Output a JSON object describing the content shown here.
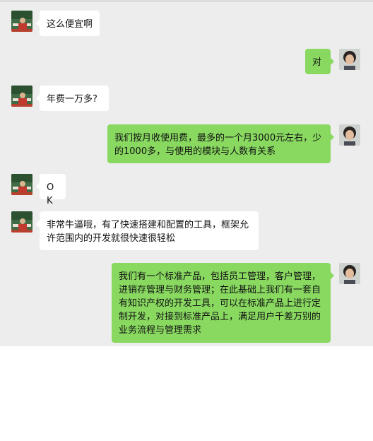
{
  "messages": [
    {
      "side": "in",
      "text": "这么便宜啊",
      "avatar": "contact-avatar"
    },
    {
      "side": "out",
      "text": "对",
      "avatar": "self-avatar"
    },
    {
      "side": "in",
      "text": "年费一万多?",
      "avatar": "contact-avatar"
    },
    {
      "side": "out",
      "text": "我们按月收使用费，最多的一个月3000元左右，少的1000多，与使用的模块与人数有关系",
      "avatar": "self-avatar"
    },
    {
      "side": "in",
      "text": "OK",
      "avatar": "contact-avatar"
    },
    {
      "side": "in",
      "text": "非常牛逼哦，有了快速搭建和配置的工具，框架允许范围内的开发就很快速很轻松",
      "avatar": "contact-avatar"
    },
    {
      "side": "out",
      "text": "我们有一个标准产品，包括员工管理，客户管理，进销存管理与财务管理；在此基础上我们有一套自有知识产权的开发工具，可以在标准产品上进行定制开发，对接到标准产品上，满足用户千差万别的业务流程与管理需求",
      "avatar": "self-avatar"
    }
  ],
  "colors": {
    "chat_bg": "#ededed",
    "incoming_bubble": "#ffffff",
    "outgoing_bubble": "#89d961"
  }
}
